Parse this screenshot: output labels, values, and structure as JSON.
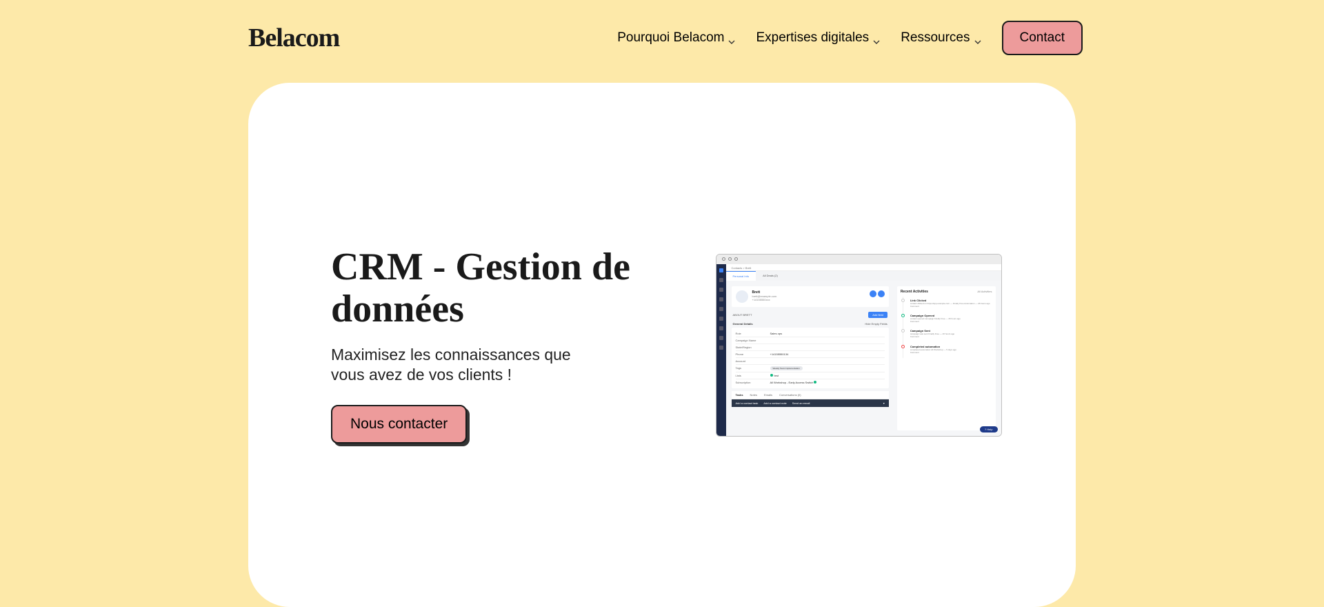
{
  "brand": "Belacom",
  "nav": {
    "items": [
      {
        "label": "Pourquoi Belacom"
      },
      {
        "label": "Expertises digitales"
      },
      {
        "label": "Ressources"
      }
    ],
    "contact": "Contact"
  },
  "hero": {
    "title": "CRM - Gestion de données",
    "subtitle": "Maximisez les connaissances que vous avez de vos clients !",
    "cta": "Nous contacter"
  },
  "mockup": {
    "breadcrumb": "Contacts  >  Brett",
    "tabs": {
      "personal": "Personal Info",
      "deals": "All Deals (2)"
    },
    "profile": {
      "name": "Brett",
      "email": "brett@example.com",
      "phone": "+14155550xxx"
    },
    "about_label": "ABOUT BRETT",
    "add_field": "Add field",
    "field_filter": "Hide Empty Fields",
    "details_header": "General Details",
    "details": [
      {
        "label": "Role",
        "value": "Sales ops"
      },
      {
        "label": "Campaign Name",
        "value": ""
      },
      {
        "label": "State/Region",
        "value": ""
      },
      {
        "label": "Phone",
        "value": "+14155550134"
      },
      {
        "label": "Account",
        "value": ""
      },
      {
        "label": "Tags",
        "value": "Weekly Team Implementation"
      },
      {
        "label": "Lists",
        "value": "test"
      },
      {
        "label": "Subscription",
        "value": "All Workshop - Early Access Switch"
      }
    ],
    "bottom_tabs": [
      "Tasks",
      "Notes",
      "Emails",
      "Conversations (0)"
    ],
    "dark_actions": [
      "Add a contact task",
      "Add a contact note",
      "Send an email"
    ],
    "activities": {
      "header": "Recent Activities",
      "filter": "All Activities",
      "items": [
        {
          "title": "Link Clicked",
          "desc": "contact clicked on https://app.example.com — Finally Free Automation — 26 hours ago",
          "marker": "grey",
          "comment": "Comment"
        },
        {
          "title": "Campaign Opened",
          "desc": "contact opened campaign Finally Free — 26 hours ago",
          "marker": "green",
          "comment": "Comment"
        },
        {
          "title": "Campaign Sent",
          "desc": "campaign was sent Finally Free — 26 hours ago",
          "marker": "grey",
          "comment": "Comment"
        },
        {
          "title": "Completed automation",
          "desc": "completed automation All Workshop — 5 days ago",
          "marker": "red",
          "comment": "Comment"
        }
      ]
    },
    "help": "Help"
  }
}
